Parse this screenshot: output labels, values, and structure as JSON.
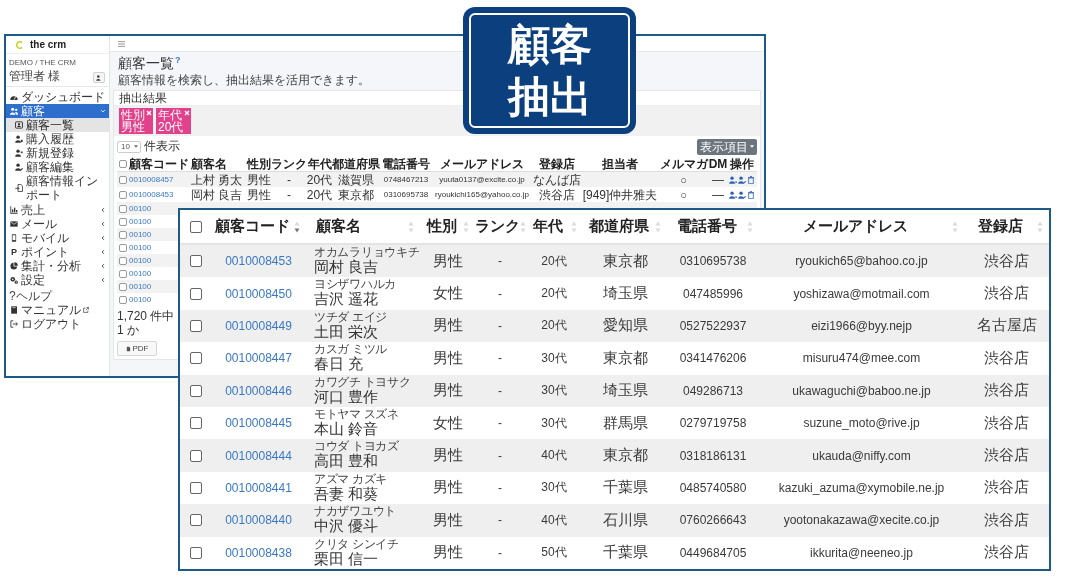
{
  "badge": {
    "text": "顧客抽出"
  },
  "screenshot": {
    "sidebar": {
      "logo": "the crm",
      "account": "DEMO / THE CRM",
      "user": "管理者 様",
      "items": [
        {
          "label": "ダッシュボード",
          "selected": false
        },
        {
          "label": "顧客",
          "selected": true,
          "expanded": true,
          "children": [
            {
              "label": "顧客一覧",
              "selected": true
            },
            {
              "label": "購入履歴",
              "selected": false
            },
            {
              "label": "新規登録",
              "selected": false
            },
            {
              "label": "顧客編集",
              "selected": false
            },
            {
              "label": "顧客情報インポート",
              "selected": false
            }
          ]
        },
        {
          "label": "売上",
          "selected": false,
          "expanded": false
        },
        {
          "label": "メール",
          "selected": false,
          "expanded": false
        },
        {
          "label": "モバイル",
          "selected": false,
          "expanded": false
        },
        {
          "label": "ポイント",
          "selected": false,
          "expanded": false,
          "glyph": "P"
        },
        {
          "label": "集計・分析",
          "selected": false,
          "expanded": false
        },
        {
          "label": "設定",
          "selected": false,
          "expanded": false
        }
      ],
      "help_heading": "?ヘルプ",
      "help_items": [
        {
          "label": "マニュアル",
          "external": true
        },
        {
          "label": "ログアウト",
          "external": false
        }
      ]
    },
    "page": {
      "title": "顧客一覧",
      "help": "?",
      "subtitle": "顧客情報を検索し、抽出結果を活用できます。"
    },
    "card": {
      "title": "抽出結果",
      "filters": [
        {
          "label": "性別",
          "value": "男性"
        },
        {
          "label": "年代",
          "value": "20代"
        }
      ],
      "page_size": "10",
      "page_size_label": "件表示",
      "columns_button": "表示項目",
      "all_checked": false,
      "columns": [
        "顧客コード",
        "顧客名",
        "性別",
        "ランク",
        "年代",
        "都道府県",
        "電話番号",
        "メールアドレス",
        "登録店",
        "担当者",
        "メルマガ",
        "DM",
        "操作"
      ],
      "rows": [
        {
          "kind": "full",
          "checked": false,
          "code": "0010008457",
          "name": "上村 勇太",
          "gender": "男性",
          "rank": "-",
          "age": "20代",
          "pref": "滋賀県",
          "tel": "0748467213",
          "email": "yuuta0137@excite.co.jp",
          "store": "なんば店",
          "mailmag": "○",
          "dm": "—"
        },
        {
          "kind": "full",
          "checked": false,
          "code": "0010008453",
          "name": "岡村 良吉",
          "gender": "男性",
          "rank": "-",
          "age": "20代",
          "pref": "東京都",
          "tel": "0310695738",
          "email": "ryoukichi165@yahoo.co.jp",
          "store": "渋谷店",
          "staff": "[949]仲井雅夫",
          "mailmag": "○",
          "dm": "—"
        },
        {
          "kind": "cut",
          "checked": false,
          "code": "00100"
        },
        {
          "kind": "cut",
          "checked": false,
          "code": "00100"
        },
        {
          "kind": "cut",
          "checked": false,
          "code": "00100"
        },
        {
          "kind": "cut",
          "checked": false,
          "code": "00100"
        },
        {
          "kind": "cut",
          "checked": false,
          "code": "00100"
        },
        {
          "kind": "cut",
          "checked": false,
          "code": "00100"
        },
        {
          "kind": "cut",
          "checked": false,
          "code": "00100"
        },
        {
          "kind": "cut",
          "checked": false,
          "code": "00100"
        }
      ],
      "footer": "1,720 件中 1 か",
      "pdf_button": "PDF"
    }
  },
  "table": {
    "all_checked": false,
    "columns": [
      {
        "label": "顧客コード",
        "sorted": true
      },
      {
        "label": "顧客名",
        "sorted": false
      },
      {
        "label": "性別",
        "sorted": false
      },
      {
        "label": "ランク",
        "sorted": false
      },
      {
        "label": "年代",
        "sorted": false
      },
      {
        "label": "都道府県",
        "sorted": false
      },
      {
        "label": "電話番号",
        "sorted": false
      },
      {
        "label": "メールアドレス",
        "sorted": false
      },
      {
        "label": "登録店",
        "sorted": false
      }
    ],
    "rows": [
      {
        "checked": false,
        "code": "0010008453",
        "kana": "オカムラリョウキチ",
        "name": "岡村 良吉",
        "gender": "男性",
        "rank": "-",
        "age": "20代",
        "pref": "東京都",
        "tel": "0310695738",
        "email": "ryoukich65@bahoo.co.jp",
        "store": "渋谷店"
      },
      {
        "checked": false,
        "code": "0010008450",
        "kana": "ヨシザワハルカ",
        "name": "吉沢 遥花",
        "gender": "女性",
        "rank": "-",
        "age": "20代",
        "pref": "埼玉県",
        "tel": "047485996",
        "email": "yoshizawa@motmail.com",
        "store": "渋谷店"
      },
      {
        "checked": false,
        "code": "0010008449",
        "kana": "ツチダ エイジ",
        "name": "土田 栄次",
        "gender": "男性",
        "rank": "-",
        "age": "20代",
        "pref": "愛知県",
        "tel": "0527522937",
        "email": "eizi1966@byy.nejp",
        "store": "名古屋店"
      },
      {
        "checked": false,
        "code": "0010008447",
        "kana": "カスガ ミツル",
        "name": "春日 充",
        "gender": "男性",
        "rank": "-",
        "age": "30代",
        "pref": "東京都",
        "tel": "0341476206",
        "email": "misuru474@mee.com",
        "store": "渋谷店"
      },
      {
        "checked": false,
        "code": "0010008446",
        "kana": "カワグチ トヨサク",
        "name": "河口 豊作",
        "gender": "男性",
        "rank": "-",
        "age": "30代",
        "pref": "埼玉県",
        "tel": "049286713",
        "email": "ukawaguchi@baboo.ne.jp",
        "store": "渋谷店"
      },
      {
        "checked": false,
        "code": "0010008445",
        "kana": "モトヤマ スズネ",
        "name": "本山 鈴音",
        "gender": "女性",
        "rank": "-",
        "age": "30代",
        "pref": "群馬県",
        "tel": "0279719758",
        "email": "suzune_moto@rive.jp",
        "store": "渋谷店"
      },
      {
        "checked": false,
        "code": "0010008444",
        "kana": "コウダ トヨカズ",
        "name": "高田 豊和",
        "gender": "男性",
        "rank": "-",
        "age": "40代",
        "pref": "東京都",
        "tel": "0318186131",
        "email": "ukauda@niffy.com",
        "store": "渋谷店"
      },
      {
        "checked": false,
        "code": "0010008441",
        "kana": "アズマ カズキ",
        "name": "吾妻 和葵",
        "gender": "男性",
        "rank": "-",
        "age": "30代",
        "pref": "千葉県",
        "tel": "0485740580",
        "email": "kazuki_azuma@xymobile.ne.jp",
        "store": "渋谷店"
      },
      {
        "checked": false,
        "code": "0010008440",
        "kana": "ナカザワユウト",
        "name": "中沢 優斗",
        "gender": "男性",
        "rank": "-",
        "age": "40代",
        "pref": "石川県",
        "tel": "0760266643",
        "email": "yootonakazawa@xecite.co.jp",
        "store": "渋谷店"
      },
      {
        "checked": false,
        "code": "0010008438",
        "kana": "クリタ シンイチ",
        "name": "栗田 信一",
        "gender": "男性",
        "rank": "-",
        "age": "50代",
        "pref": "千葉県",
        "tel": "0449684705",
        "email": "ikkurita@neeneo.jp",
        "store": "渋谷店"
      }
    ]
  }
}
